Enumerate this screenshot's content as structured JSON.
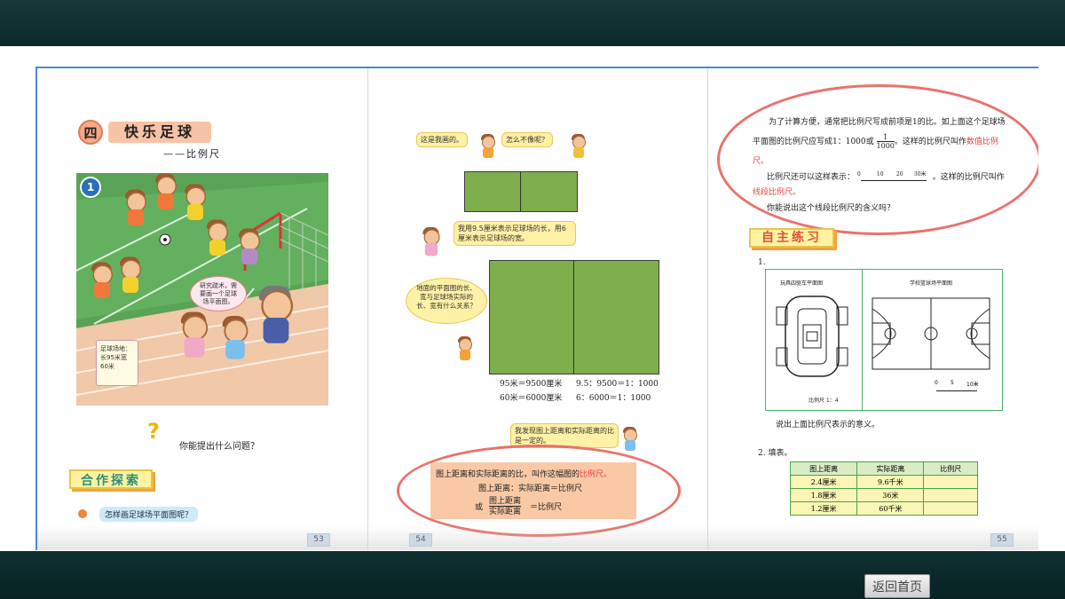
{
  "viewer": {
    "home_button": "返回首页"
  },
  "page53": {
    "chapter_no": "四",
    "chapter_title": "快乐足球",
    "subtitle": "——比例尺",
    "panel_no": "1",
    "speech": "研究疏术，需要画一个足球场平面图。",
    "sign": "足球场地：长95米宽60米",
    "question": "你能提出什么问题？",
    "section": "合作探索",
    "prompt": "怎样画足球场平面图呢？",
    "page_number": "53"
  },
  "page54": {
    "bubble1": "这是我画的。",
    "bubble2": "怎么不像呢？",
    "bubble3": "我用9.5厘米表示足球场的长，用6厘米表示足球场的宽。",
    "bubble4": "地面的平面图的长、宽与足球场实际的长、宽有什么关系？",
    "calc_left_1": "95米＝9500厘米",
    "calc_left_2": "60米＝6000厘米",
    "calc_right_1": "9.5：9500＝1：1000",
    "calc_right_2": "6：6000＝1：1000",
    "bubble5": "我发现图上距离和实际距离的比是一定的。",
    "definition_main": "图上距离和实际距离的比，叫作这幅图的",
    "definition_term": "比例尺。",
    "formula1": "图上距离：实际距离＝比例尺",
    "formula2_or": "或",
    "formula2_num": "图上距离",
    "formula2_den": "实际距离",
    "formula2_rhs": "＝比例尺",
    "page_number": "54"
  },
  "page55": {
    "para1": "为了计算方便，通常把比例尺写成前项是1的比。如上面这个足球场平面图的比例尺应写成1：1000或",
    "fraction_num": "1",
    "fraction_den": "1000",
    "para1_end": "。这样的比例尺叫作",
    "term1": "数值比例尺。",
    "para2": "比例尺还可以这样表示：",
    "scale_ticks": [
      "0",
      "10",
      "20",
      "30米"
    ],
    "para2_end": "。这样的比例尺叫作",
    "term2": "线段比例尺。",
    "para3": "你能说出这个线段比例尺的含义吗？",
    "section": "自主练习",
    "ex1_no": "1.",
    "map1_title": "玩具四驱车平面图",
    "map1_scale": "比例尺  1：4",
    "map2_title": "学校篮球场平面图",
    "map2_ticks": [
      "0",
      "5",
      "10米"
    ],
    "ex1_q": "说出上面比例尺表示的意义。",
    "ex2": "2. 填表。",
    "table": {
      "headers": [
        "图上距离",
        "实际距离",
        "比例尺"
      ],
      "rows": [
        [
          "2.4厘米",
          "9.6千米",
          ""
        ],
        [
          "1.8厘米",
          "36米",
          ""
        ],
        [
          "1.2厘米",
          "60千米",
          ""
        ]
      ]
    },
    "page_number": "55"
  },
  "colors": {
    "bar": "#0b2a2b",
    "book_border": "#4c87d8",
    "highlight": "#e8413a",
    "field": "#7fae4c"
  }
}
